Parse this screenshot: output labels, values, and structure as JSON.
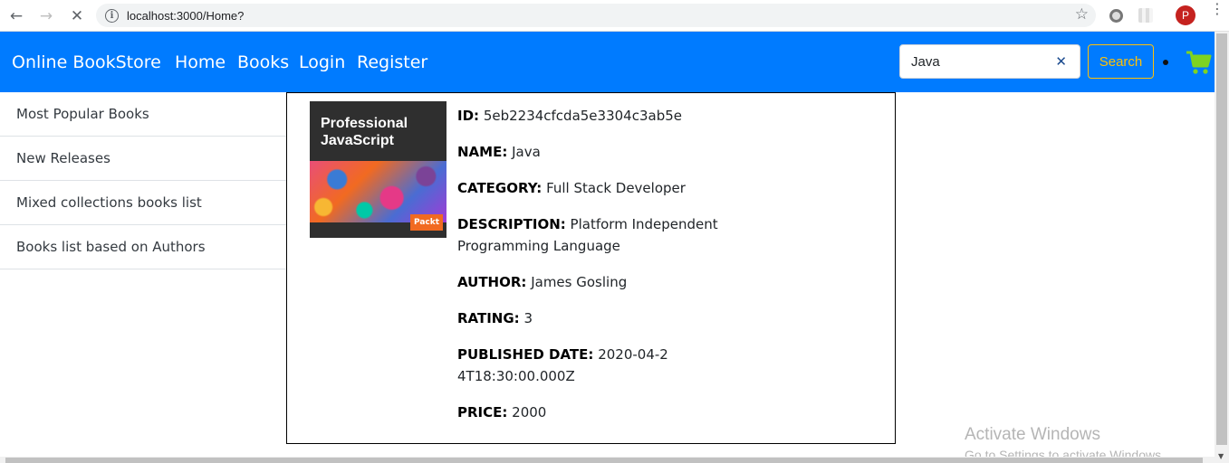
{
  "browser": {
    "url": "localhost:3000/Home?",
    "profile_initial": "P"
  },
  "navbar": {
    "brand": "Online BookStore",
    "links": [
      "Home",
      "Books",
      "Login",
      "Register"
    ],
    "search_value": "Java",
    "search_button": "Search",
    "colors": {
      "navbar_bg": "#007bff",
      "search_button": "#ffc107",
      "cart": "#7ed321"
    }
  },
  "sidebar": {
    "items": [
      "Most Popular Books",
      "New Releases",
      "Mixed collections books list",
      "Books list based on Authors"
    ]
  },
  "book": {
    "cover": {
      "title_line1": "Professional",
      "title_line2": "JavaScript",
      "publisher": "Packt"
    },
    "fields": [
      {
        "label": "ID:",
        "value": "5eb2234cfcda5e3304c3ab5e"
      },
      {
        "label": "NAME:",
        "value": "Java"
      },
      {
        "label": "CATEGORY:",
        "value": "Full Stack Developer"
      },
      {
        "label": "DESCRIPTION:",
        "value": "Platform Independent Programming Language"
      },
      {
        "label": "AUTHOR:",
        "value": "James Gosling"
      },
      {
        "label": "RATING:",
        "value": "3"
      },
      {
        "label": "PUBLISHED DATE:",
        "value": "2020-04-24T18:30:00.000Z"
      },
      {
        "label": "PRICE:",
        "value": "2000"
      }
    ]
  },
  "watermark": {
    "line1": "Activate Windows",
    "line2": "Go to Settings to activate Windows."
  }
}
